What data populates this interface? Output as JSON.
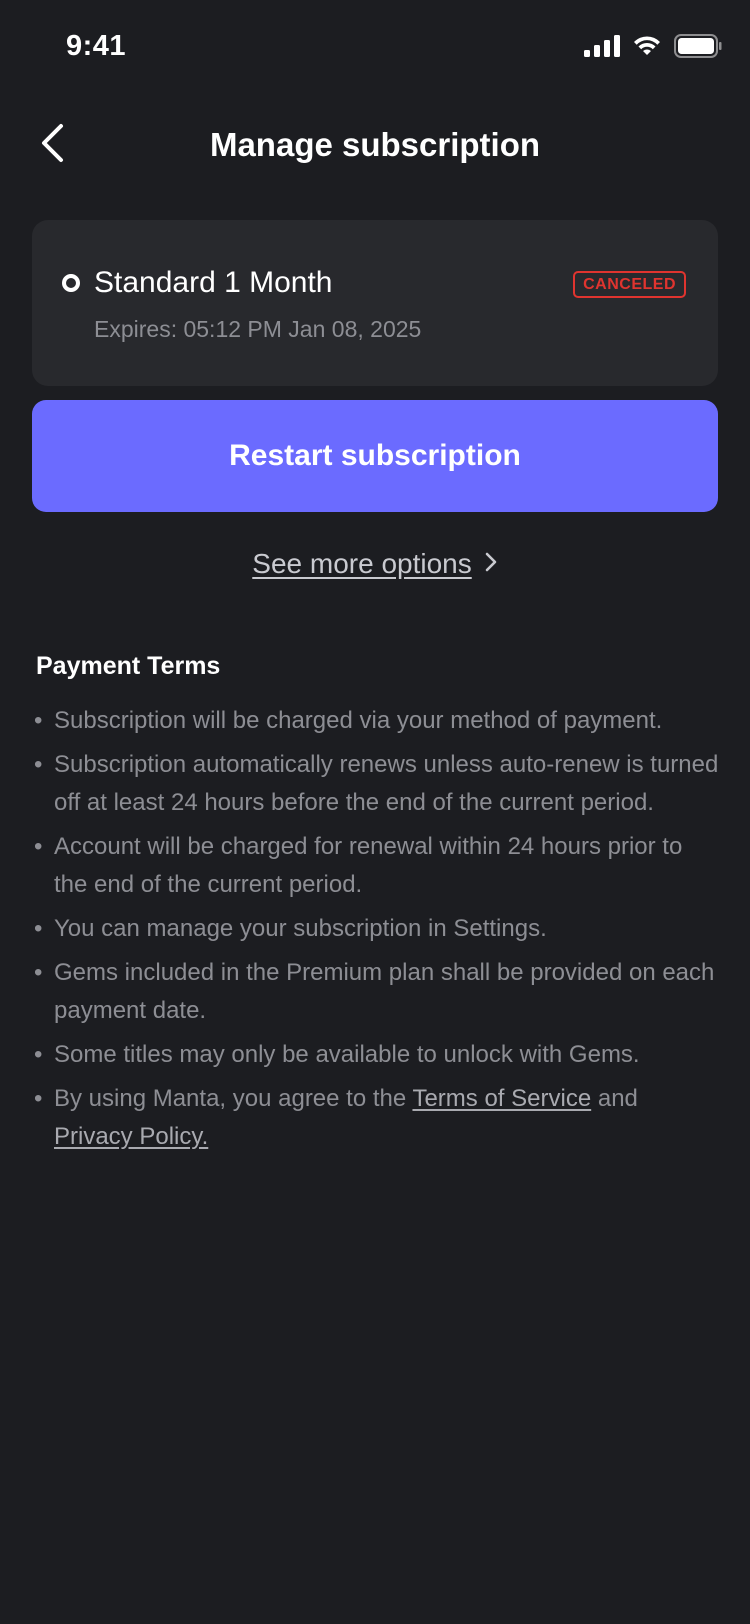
{
  "status_bar": {
    "time": "9:41",
    "icons": [
      "cellular-signal-icon",
      "wifi-icon",
      "battery-icon"
    ]
  },
  "header": {
    "back_icon": "chevron-left-icon",
    "title": "Manage subscription"
  },
  "subscription": {
    "plan_name": "Standard 1 Month",
    "status": "CANCELED",
    "expires": "Expires: 05:12 PM Jan 08, 2025"
  },
  "actions": {
    "restart_label": "Restart subscription",
    "see_more_label": "See more options",
    "see_more_icon": "chevron-right-icon"
  },
  "payment_terms": {
    "heading": "Payment Terms",
    "items": [
      "Subscription will be charged via your method of payment.",
      "Subscription automatically renews unless auto-renew is turned off at least 24 hours before the end of the current period.",
      "Account will be charged for renewal within 24 hours prior to the end of the current period.",
      "You can manage your subscription in Settings.",
      "Gems included in the Premium plan shall be provided on each payment date.",
      "Some titles may only be available to unlock with Gems."
    ],
    "last_item": {
      "prefix": "By using Manta, you agree to the ",
      "tos_link": "Terms of Service",
      "middle": " and ",
      "privacy_link": "Privacy Policy."
    }
  },
  "colors": {
    "background": "#1c1d21",
    "card": "#28292d",
    "accent": "#6b6bff",
    "canceled": "#e0342f",
    "muted_text": "#8d8e94"
  }
}
